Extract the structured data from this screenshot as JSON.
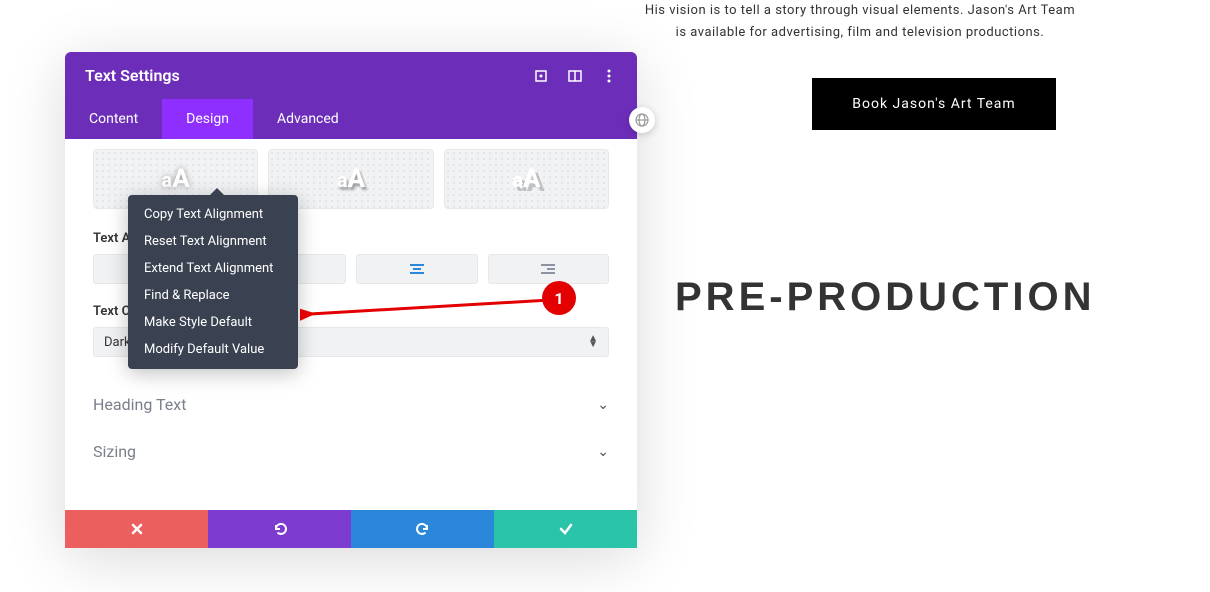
{
  "background": {
    "textLine1": "His vision is to tell a story through visual elements. Jason's Art Team",
    "textLine2": "is available for advertising, film and television productions.",
    "bookBtn": "Book Jason's Art Team",
    "heading": "PRE-PRODUCTION"
  },
  "panel": {
    "title": "Text Settings",
    "tabs": {
      "content": "Content",
      "design": "Design",
      "advanced": "Advanced"
    },
    "labels": {
      "textAlign": "Text Alignment",
      "textColor": "Text Color",
      "dark": "Dark",
      "headingText": "Heading Text",
      "sizing": "Sizing"
    },
    "shadowGlyph": "aA"
  },
  "contextMenu": {
    "copy": "Copy Text Alignment",
    "reset": "Reset Text Alignment",
    "extend": "Extend Text Alignment",
    "findReplace": "Find & Replace",
    "makeDefault": "Make Style Default",
    "modifyDefault": "Modify Default Value"
  },
  "annotation": {
    "badge": "1"
  }
}
